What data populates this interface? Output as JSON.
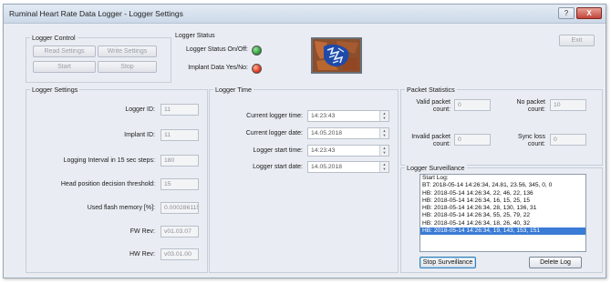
{
  "window": {
    "title": "Ruminal Heart Rate Data Logger - Logger Settings",
    "help_label": "?",
    "minimize_label": "–",
    "close_label": "X"
  },
  "exit_label": "Exit",
  "logger_control": {
    "title": "Logger Control",
    "read_settings": "Read Settings",
    "write_settings": "Write Settings",
    "start": "Start",
    "stop": "Stop"
  },
  "logger_status": {
    "title": "Logger Status",
    "status_label": "Logger Status On/Off:",
    "status_color": "#2e9e3a",
    "implant_label": "Implant Data Yes/No:",
    "implant_color": "#e03a1e"
  },
  "logger_settings": {
    "title": "Logger Settings",
    "logger_id_label": "Logger ID:",
    "logger_id": "11",
    "implant_id_label": "Implant ID:",
    "implant_id": "11",
    "interval_label": "Logging Interval in 15 sec steps:",
    "interval": "180",
    "threshold_label": "Head position decision threshold:",
    "threshold": "15",
    "flash_label": "Used flash memory [%]:",
    "flash": "0.000286115",
    "fw_label": "FW Rev:",
    "fw": "v01.03.07",
    "hw_label": "HW Rev:",
    "hw": "v03.01.00"
  },
  "logger_time": {
    "title": "Logger Time",
    "current_time_label": "Current logger time:",
    "current_time": "14:23:43",
    "current_date_label": "Current logger date:",
    "current_date": "14.05.2018",
    "start_time_label": "Logger start time:",
    "start_time": "14:23:43",
    "start_date_label": "Logger start date:",
    "start_date": "14.05.2018"
  },
  "packet_statistics": {
    "title": "Packet Statistics",
    "valid_label_1": "Valid packet",
    "valid_label_2": "count:",
    "valid": "0",
    "no_packet_label_1": "No packet",
    "no_packet_label_2": "count:",
    "no_packet": "10",
    "invalid_label_1": "Invalid packet",
    "invalid_label_2": "count:",
    "invalid": "0",
    "sync_label_1": "Sync loss",
    "sync_label_2": "count:",
    "sync": "0"
  },
  "logger_surveillance": {
    "title": "Logger Surveillance",
    "log_lines": [
      "Start Log:",
      "BT: 2018-05-14 14:26:34, 24.81, 23.56, 345, 0, 0",
      "HB: 2018-05-14 14:26:34, 22, 46, 22, 136",
      "HB: 2018-05-14 14:26:34, 16, 15, 25, 15",
      "HB: 2018-05-14 14:26:34, 28, 130, 136, 31",
      "HB: 2018-05-14 14:26:34, 55, 25, 79, 22",
      "HB: 2018-05-14 14:26:34, 18, 26, 40, 32",
      "HB: 2018-05-14 14:26:34, 19, 143, 153, 151"
    ],
    "selected_index": 7,
    "stop_button": "Stop Surveillance",
    "delete_button": "Delete Log"
  }
}
